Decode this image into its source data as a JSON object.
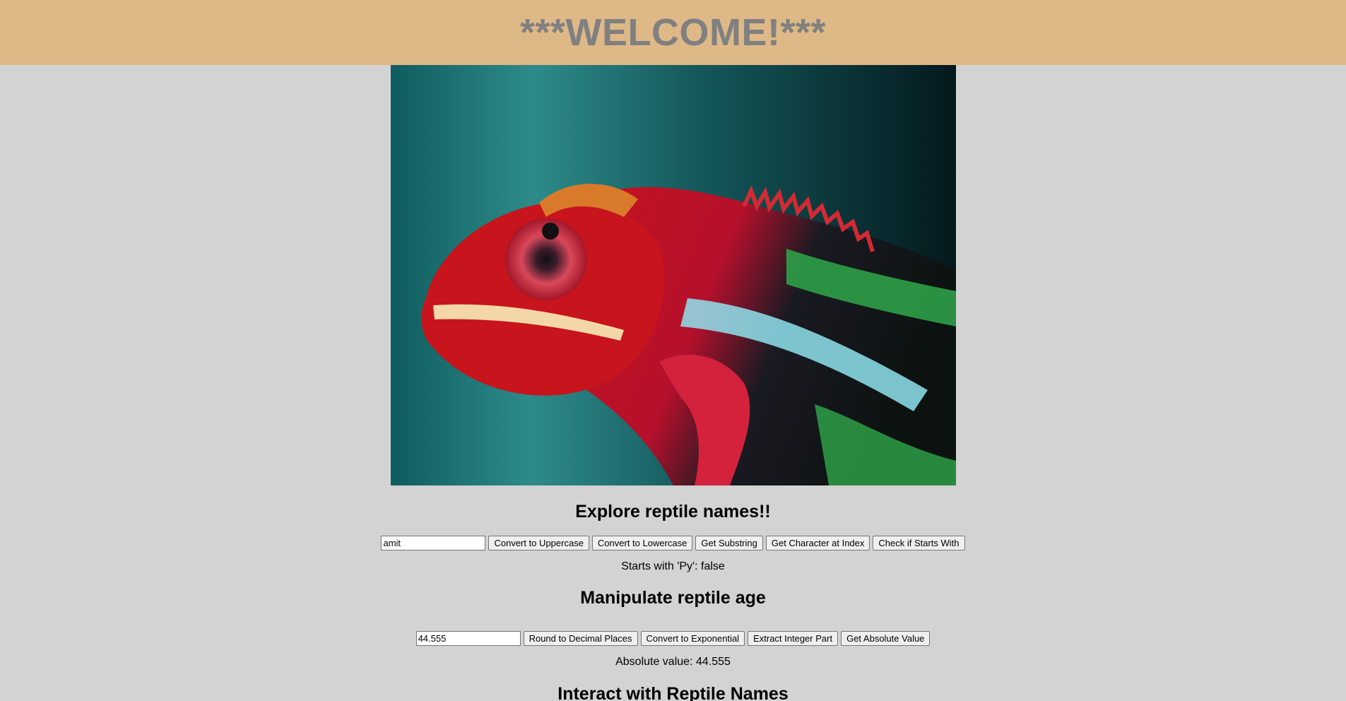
{
  "header": {
    "title": "***WELCOME!***"
  },
  "hero_image": {
    "subject": "colorful chameleon photo"
  },
  "names_section": {
    "heading": "Explore reptile names!!",
    "input_value": "amit",
    "buttons": [
      "Convert to Uppercase",
      "Convert to Lowercase",
      "Get Substring",
      "Get Character at Index",
      "Check if Starts With"
    ],
    "result": "Starts with 'Py': false"
  },
  "age_section": {
    "heading": "Manipulate reptile age",
    "input_value": "44.555",
    "buttons": [
      "Round to Decimal Places",
      "Convert to Exponential",
      "Extract Integer Part",
      "Get Absolute Value"
    ],
    "result": "Absolute value: 44.555"
  },
  "interact_section": {
    "heading": "Interact with Reptile Names"
  },
  "colors": {
    "header_bg": "#deb887",
    "header_text": "#808080",
    "page_bg": "#d3d3d3"
  }
}
